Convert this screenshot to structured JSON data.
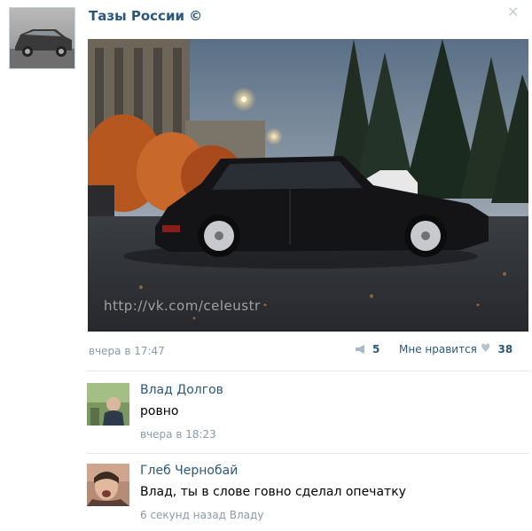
{
  "post": {
    "author": "Тазы России ©",
    "photo_watermark": "http://vk.com/celeustr",
    "time": "вчера в 17:47",
    "shares": "5",
    "like_label": "Мне нравится",
    "likes": "38"
  },
  "comments": [
    {
      "author": "Влад Долгов",
      "text": "ровно",
      "time": "вчера в 18:23"
    },
    {
      "author": "Глеб Чернобай",
      "text": "Влад, ты в слове говно сделал опечатку",
      "time": "6 секунд назад Владу"
    }
  ],
  "colors": {
    "link": "#2b587a",
    "meta": "#8a9aa8",
    "divider": "#e4e8ed"
  }
}
